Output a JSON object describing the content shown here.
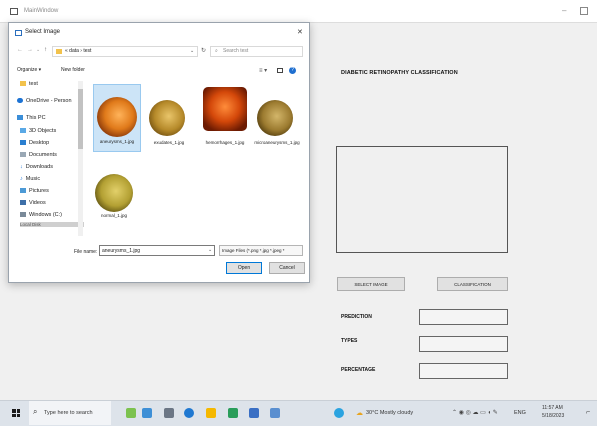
{
  "main_window": {
    "title": "MainWindow",
    "heading": "DIABETIC RETINOPATHY CLASSIFICATION",
    "buttons": {
      "select": "SELECT IMAGE",
      "classify": "CLASSIFICATION"
    },
    "labels": {
      "prediction": "PREDICTION",
      "types": "TYPES",
      "percentage": "PERCENTAGE"
    },
    "controls": {
      "minimize": "–"
    }
  },
  "dialog": {
    "title": "Select Image",
    "close": "✕",
    "breadcrumb": "« data › test",
    "search_placeholder": "Search test",
    "organize": "Organize ▾",
    "new_folder": "New folder",
    "nav_items": [
      "test",
      "OneDrive - Person",
      "This PC",
      "3D Objects",
      "Desktop",
      "Documents",
      "Downloads",
      "Music",
      "Pictures",
      "Videos",
      "Windows (C:)",
      "Local Disk"
    ],
    "files": [
      "aneurysms_1.jpg",
      "exudates_1.jpg",
      "hemorrhages_1.jpg",
      "microaneurysms_1.jpg",
      "normal_1.jpg"
    ],
    "filename_label": "File name:",
    "filename_value": "aneurysms_1.jpg",
    "filter_value": "Image Files (*.png *.jpg *.jpeg *",
    "open": "Open",
    "cancel": "Cancel"
  },
  "taskbar": {
    "search_placeholder": "Type here to search",
    "weather": "30°C  Mostly cloudy",
    "lang": "ENG",
    "time": "11:57 AM",
    "date": "5/18/2023"
  }
}
